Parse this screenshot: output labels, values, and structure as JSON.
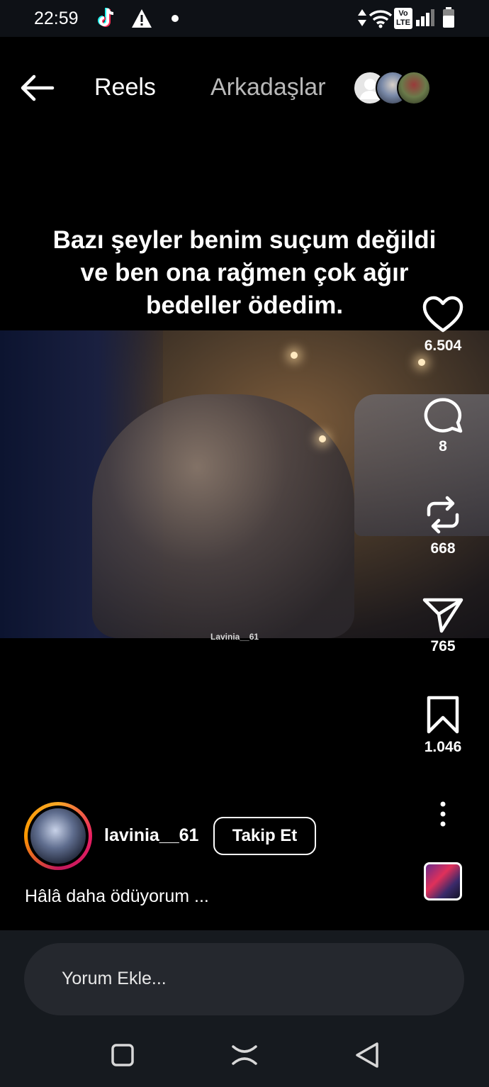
{
  "status_bar": {
    "time": "22:59",
    "icons": [
      "tiktok-icon",
      "warning-icon",
      "notification-dot",
      "data-arrows-icon",
      "wifi-icon",
      "volte-icon",
      "signal-icon",
      "battery-icon"
    ],
    "volte_top": "Vo",
    "volte_bottom": "LTE"
  },
  "header": {
    "back_icon": "arrow-left-icon",
    "tab_reels": "Reels",
    "tab_friends": "Arkadaşlar"
  },
  "video": {
    "caption_line1": "Bazı şeyler benim suçum değildi",
    "caption_line2": "ve ben ona rağmen çok ağır",
    "caption_line3": "bedeller ödedim.",
    "watermark": "Lavinia__61"
  },
  "actions": {
    "like_count": "6.504",
    "comment_count": "8",
    "repost_count": "668",
    "share_count": "765",
    "save_count": "1.046"
  },
  "author": {
    "username": "lavinia__61",
    "follow_label": "Takip Et",
    "description": "Hâlâ daha ödüyorum ..."
  },
  "comment": {
    "placeholder": "Yorum Ekle..."
  },
  "colors": {
    "background": "#000000",
    "status_bar_bg": "#0e1116",
    "comment_bar_bg": "#161a1f",
    "comment_input_bg": "#25282e",
    "inactive_tab": "#b9b9b9"
  }
}
